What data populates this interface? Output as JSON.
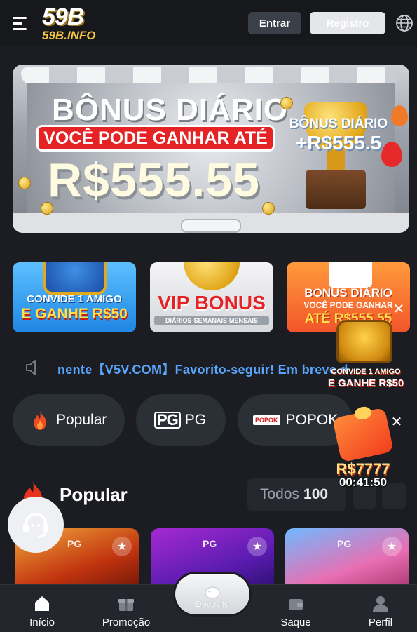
{
  "header": {
    "logo_main": "59B",
    "logo_sub": "59B.INFO",
    "login_label": "Entrar",
    "register_label": "Registro"
  },
  "hero_banner": {
    "title": "BÔNUS DIÁRIO",
    "ribbon": "VOCÊ PODE GANHAR ATÉ",
    "amount": "R$555.55",
    "side_title": "BÔNUS DIÁRIO",
    "side_amount": "+R$555.5"
  },
  "promos": [
    {
      "line1": "CONVIDE 1 AMIGO",
      "line2": "E GANHE R$50"
    },
    {
      "line1": "VIP BONUS",
      "line2": "DIÁRIOS-SEMANAIS-MENSAIS"
    },
    {
      "line1": "BONUS DIÁRIO",
      "line2": "VOCÊ PODE GANHAR",
      "line3": "ATÉ R$555.55"
    }
  ],
  "marquee": {
    "text": "nente【V5V.COM】Favorito-seguir! Em breve d"
  },
  "categories": [
    {
      "label": "Popular",
      "icon": "flame-icon"
    },
    {
      "label": "PG",
      "logo": "PG"
    },
    {
      "label": "POPOK",
      "logo": "POPOK"
    }
  ],
  "popular_section": {
    "title": "Popular",
    "filter_label": "Todos",
    "filter_count": "100"
  },
  "games": [
    {
      "provider": "PG"
    },
    {
      "provider": "PG"
    },
    {
      "provider": "PG"
    }
  ],
  "floating": {
    "chest_line1": "CONVIDE 1 AMIGO",
    "chest_line2": "E GANHE R$50",
    "gift_amount": "R$7777",
    "gift_timer": "00:41:50"
  },
  "bottom_nav": {
    "home": "Início",
    "promo": "Promoção",
    "deposit": "Depósito",
    "withdraw": "Saque",
    "profile": "Perfil"
  },
  "colors": {
    "background": "#1b1d22",
    "accent_blue": "#5aa6ff",
    "gold": "#f3c542",
    "red": "#e52324"
  }
}
